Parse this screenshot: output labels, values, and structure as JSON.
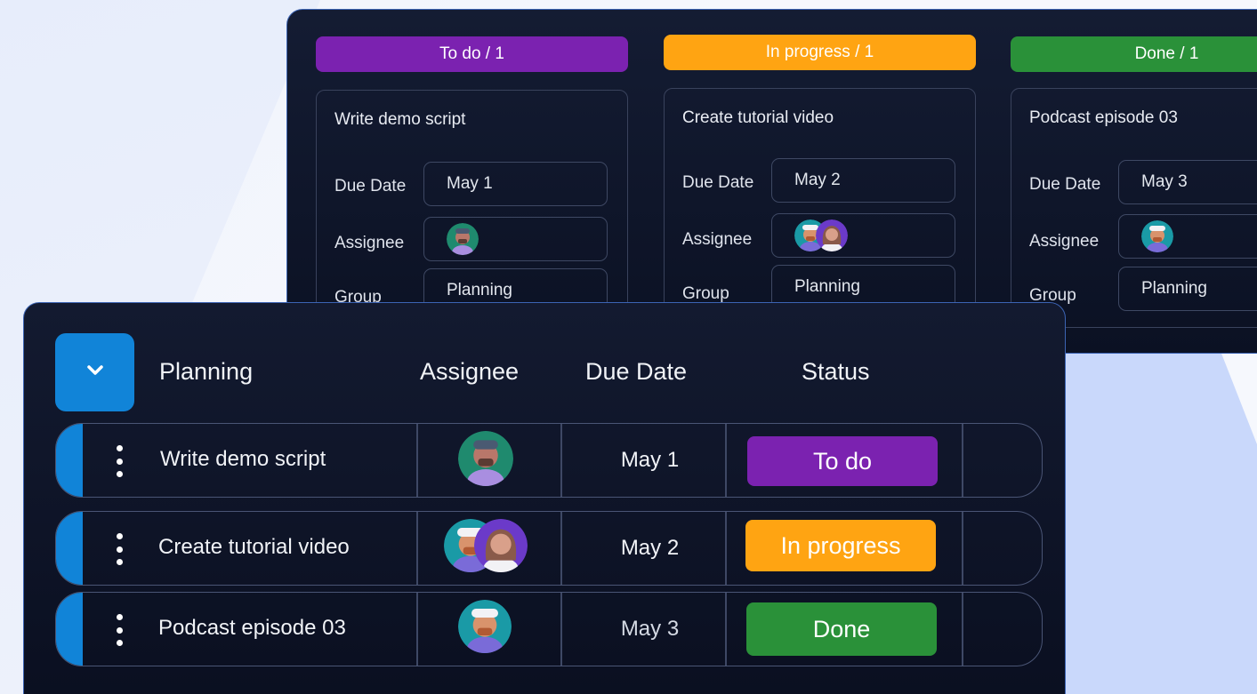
{
  "board": {
    "columns": [
      {
        "header": "To do / 1",
        "color": "#7b22b0",
        "card": {
          "title": "Write demo script",
          "due_label": "Due Date",
          "due_value": "May 1",
          "assignee_label": "Assignee",
          "assignees": [
            "man-teal-avatar"
          ],
          "group_label": "Group",
          "group_value": "Planning"
        }
      },
      {
        "header": "In progress / 1",
        "color": "#ffa412",
        "card": {
          "title": "Create tutorial video",
          "due_label": "Due Date",
          "due_value": "May 2",
          "assignee_label": "Assignee",
          "assignees": [
            "man-cap-avatar",
            "woman-purple-avatar"
          ],
          "group_label": "Group",
          "group_value": "Planning"
        }
      },
      {
        "header": "Done / 1",
        "color": "#2a9139",
        "card": {
          "title": "Podcast episode 03",
          "due_label": "Due Date",
          "due_value": "May 3",
          "assignee_label": "Assignee",
          "assignees": [
            "man-cap-avatar"
          ],
          "group_label": "Group",
          "group_value": "Planning"
        }
      }
    ]
  },
  "table": {
    "group_name": "Planning",
    "columns": {
      "assignee": "Assignee",
      "due_date": "Due Date",
      "status": "Status"
    },
    "rows": [
      {
        "title": "Write demo script",
        "date": "May 1",
        "status": "To do",
        "status_color": "#7b22b0"
      },
      {
        "title": "Create tutorial video",
        "date": "May 2",
        "status": "In progress",
        "status_color": "#ffa412"
      },
      {
        "title": "Podcast episode 03",
        "date": "May 3",
        "status": "Done",
        "status_color": "#2a9139"
      }
    ]
  },
  "colors": {
    "accent": "#1184d8",
    "panel_bg": "#0f1528",
    "border": "#3c64b4"
  }
}
